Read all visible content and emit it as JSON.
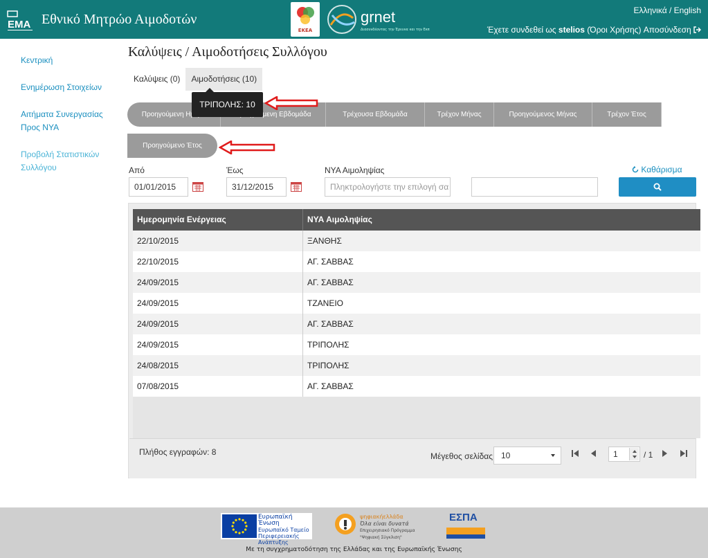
{
  "header": {
    "site_title": "Εθνικό Μητρώο Αιμοδοτών",
    "logo_text": "EMA",
    "ekea_text": "ΕΚΕΑ",
    "grnet_text": "grnet",
    "grnet_sub": "Διασυνδέοντας την Έρευνα και την Εκπ",
    "lang_link": "Ελληνικά / English",
    "logged_in_prefix": "Έχετε συνδεθεί ως",
    "username": "stelios",
    "terms_link": "(Όροι Χρήσης)",
    "logout_link": "Αποσύνδεση"
  },
  "sidebar": {
    "items": [
      {
        "label": "Κεντρική"
      },
      {
        "label": "Ενημέρωση Στοιχείων"
      },
      {
        "label": "Αιτήματα Συνεργασίας Προς ΝΥΑ"
      },
      {
        "label": "Προβολή Στατιστικών Συλλόγου"
      }
    ]
  },
  "main": {
    "page_title": "Καλύψεις / Αιμοδοτήσεις Συλλόγου",
    "tabs": [
      {
        "label": "Καλύψεις (0)"
      },
      {
        "label": "Αιμοδοτήσεις (10)"
      }
    ],
    "tooltip": "ΤΡΙΠΟΛΗΣ: 10",
    "period_buttons": [
      {
        "label": "Προηγούμενη Ημέρα"
      },
      {
        "label": "Προηγούμενη Εβδομάδα"
      },
      {
        "label": "Τρέχουσα Εβδομάδα"
      },
      {
        "label": "Τρέχον Μήνας"
      },
      {
        "label": "Προηγούμενος Μήνας"
      },
      {
        "label": "Τρέχον Έτος"
      }
    ],
    "previous_year_label": "Προηγούμενο Έτος"
  },
  "filters": {
    "from_label": "Από",
    "from_value": "01/01/2015",
    "to_label": "Έως",
    "to_value": "31/12/2015",
    "hospital_label": "ΝΥΑ Αιμοληψίας",
    "hospital_placeholder": "Πληκτρολογήστε την επιλογή σα",
    "extra_value": "",
    "clear_label": "Καθάρισμα"
  },
  "grid": {
    "columns": [
      "Ημερομηνία Ενέργειας",
      "ΝΥΑ Αιμοληψίας"
    ],
    "rows": [
      [
        "22/10/2015",
        "ΞΑΝΘΗΣ"
      ],
      [
        "22/10/2015",
        "ΑΓ. ΣΑΒΒΑΣ"
      ],
      [
        "24/09/2015",
        "ΑΓ. ΣΑΒΒΑΣ"
      ],
      [
        "24/09/2015",
        "ΤΖΑΝΕΙΟ"
      ],
      [
        "24/09/2015",
        "ΑΓ. ΣΑΒΒΑΣ"
      ],
      [
        "24/09/2015",
        "ΤΡΙΠΟΛΗΣ"
      ],
      [
        "24/08/2015",
        "ΤΡΙΠΟΛΗΣ"
      ],
      [
        "07/08/2015",
        "ΑΓ. ΣΑΒΒΑΣ"
      ]
    ],
    "total_label": "Πλήθος εγγραφών: 8",
    "page_size_label": "Μέγεθος σελίδας:",
    "page_size_value": "10",
    "current_page": "1",
    "page_total": "/ 1"
  },
  "footer": {
    "eu_text_1": "Ευρωπαϊκή Ένωση",
    "eu_text_2": "Ευρωπαϊκό Ταμείο",
    "eu_text_3": "Περιφερειακής",
    "eu_text_4": "Ανάπτυξης",
    "digital_text_1": "ψηφιακήελλάδα",
    "digital_text_2": "Όλα είναι δυνατά",
    "digital_text_3": "Επιχειρησιακό Πρόγραμμα",
    "digital_text_4": "\"Ψηφιακή Σύγκλιση\"",
    "espa_text": "ΕΣΠΑ",
    "cofunding": "Με τη συγχρηματοδότηση της Ελλάδας και της Ευρωπαϊκής Ένωσης"
  },
  "colors": {
    "header_bg": "#127a7a",
    "link": "#1a8fbf",
    "search_button": "#1f8ec4",
    "period_button": "#9b9b9b",
    "annotation_arrow": "#e01b1b"
  }
}
